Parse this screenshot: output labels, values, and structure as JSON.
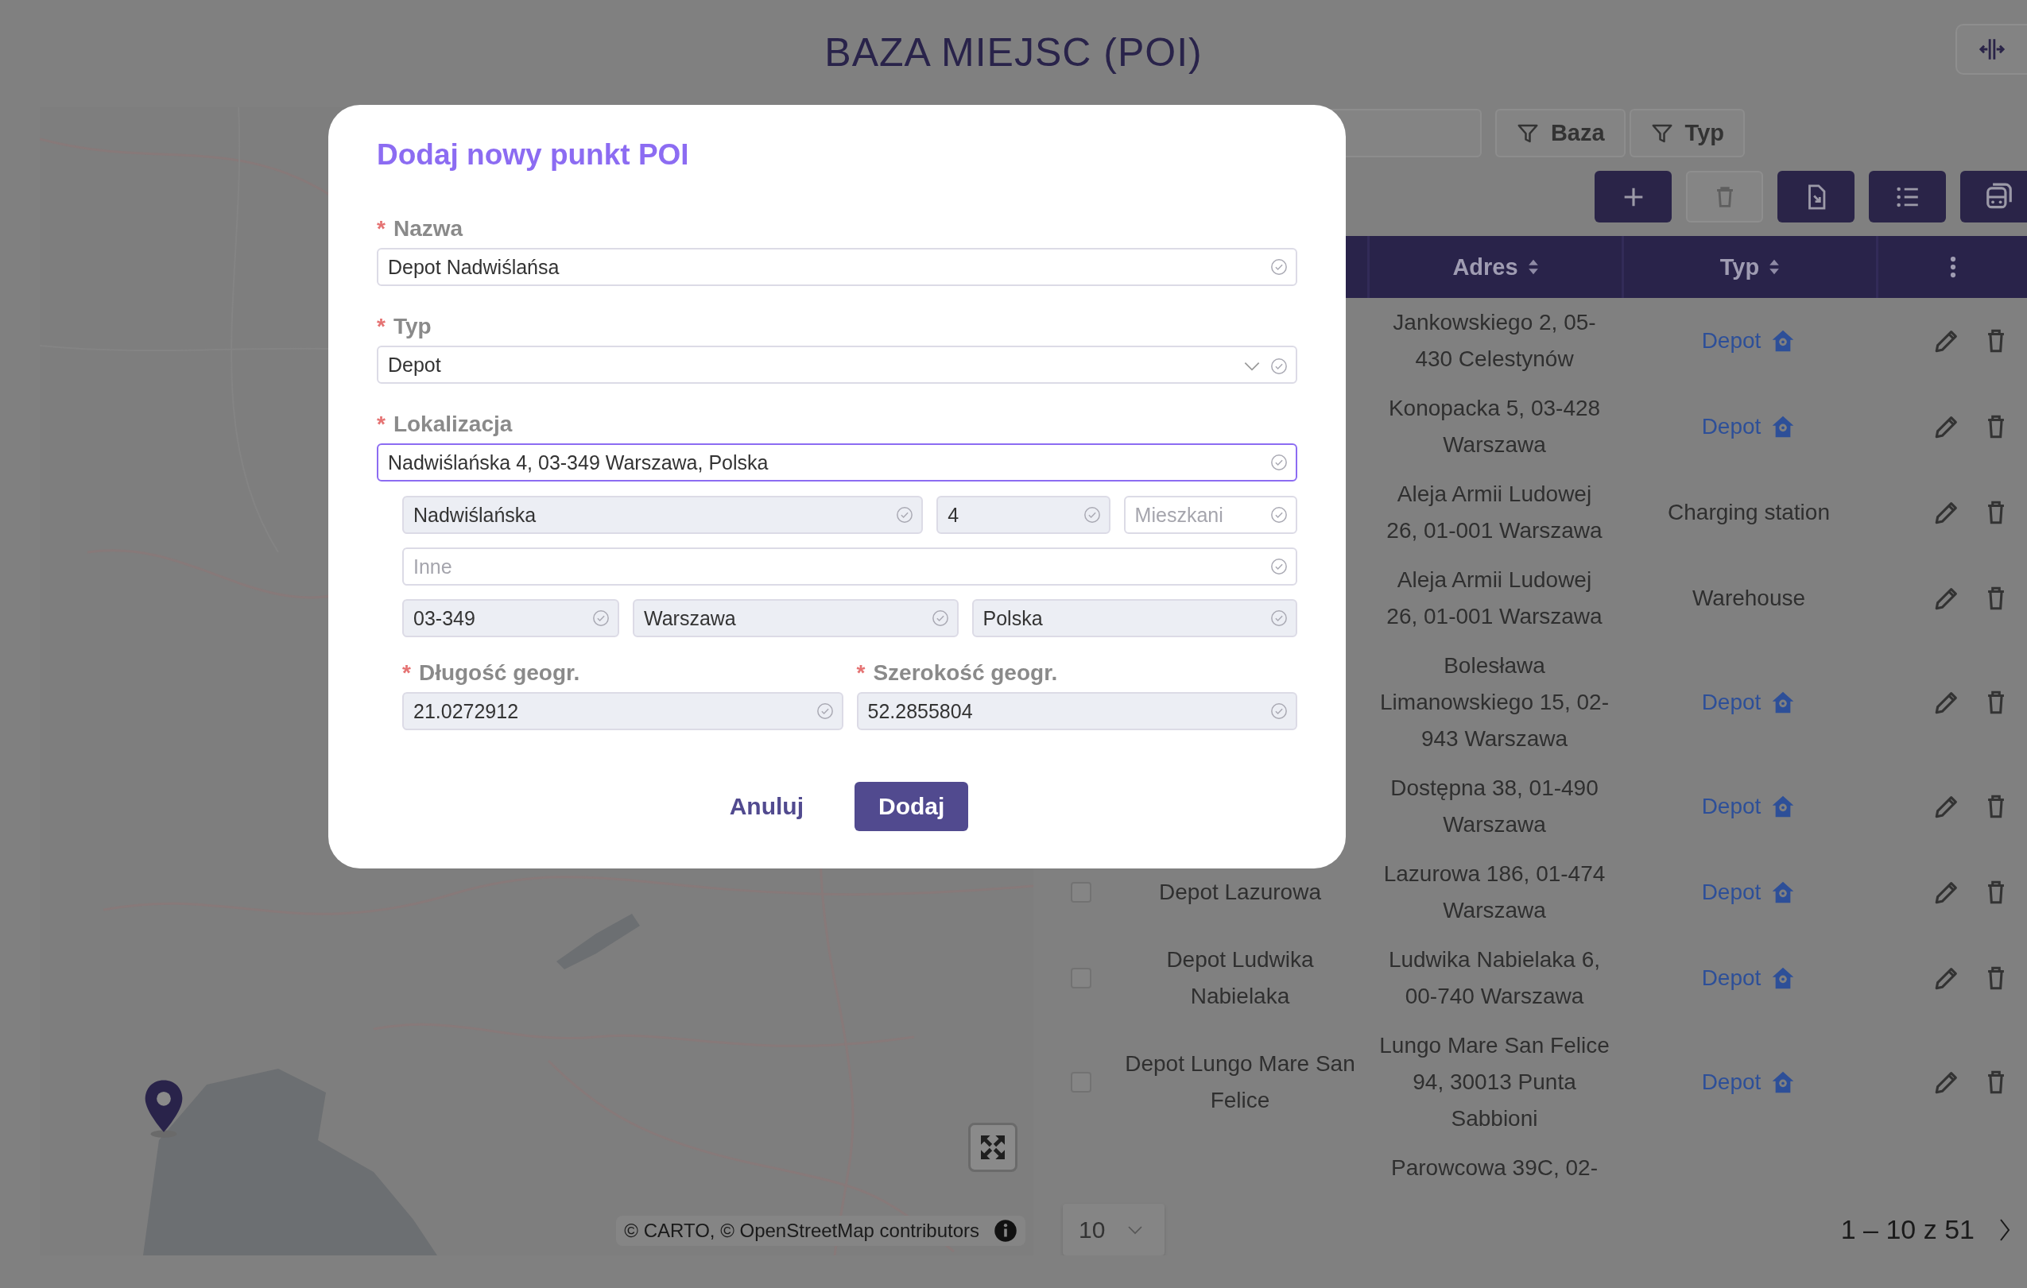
{
  "page": {
    "title": "BAZA MIEJSC (POI)"
  },
  "map": {
    "kind": "picture",
    "attribution": "© CARTO, © OpenStreetMap contributors"
  },
  "toolbar": {
    "filters": [
      {
        "label": "Baza"
      },
      {
        "label": "Typ"
      }
    ],
    "actions": [
      {
        "kind": "plus",
        "disabled": false
      },
      {
        "kind": "trash",
        "disabled": true
      },
      {
        "kind": "file",
        "disabled": false
      },
      {
        "kind": "list",
        "disabled": false
      },
      {
        "kind": "bus",
        "disabled": false
      }
    ]
  },
  "table": {
    "columns": [
      {
        "label": "Adres",
        "sortable": true
      },
      {
        "label": "Typ",
        "sortable": true
      }
    ],
    "rows": [
      {
        "kind": "row",
        "address": "Jankowskiego 2, 05-\n430 Celestynów",
        "type": {
          "label": "Depot",
          "kind": "link"
        }
      },
      {
        "kind": "row",
        "address": "Konopacka 5, 03-428\nWarszawa",
        "type": {
          "label": "Depot",
          "kind": "link"
        }
      },
      {
        "kind": "row",
        "address": "Aleja Armii Ludowej\n26, 01-001 Warszawa",
        "type": {
          "label": "Charging station",
          "kind": "plain"
        }
      },
      {
        "kind": "row",
        "address": "Aleja Armii Ludowej\n26, 01-001 Warszawa",
        "type": {
          "label": "Warehouse",
          "kind": "plain"
        }
      },
      {
        "kind": "row",
        "address": "Bolesława\nLimanowskiego 15, 02-\n943 Warszawa",
        "type": {
          "label": "Depot",
          "kind": "link"
        }
      },
      {
        "kind": "row",
        "address": "Dostępna 38, 01-490\nWarszawa",
        "type": {
          "label": "Depot",
          "kind": "link"
        }
      },
      {
        "kind": "row",
        "checked": false,
        "name": "Depot Lazurowa",
        "address": "Lazurowa 186, 01-474\nWarszawa",
        "type": {
          "label": "Depot",
          "kind": "link"
        }
      },
      {
        "kind": "row",
        "checked": false,
        "name": "Depot Ludwika\nNabielaka",
        "address": "Ludwika Nabielaka 6,\n00-740 Warszawa",
        "type": {
          "label": "Depot",
          "kind": "link"
        }
      },
      {
        "kind": "row",
        "checked": false,
        "name": "Depot Lungo Mare San\nFelice",
        "address": "Lungo Mare San Felice\n94, 30013 Punta\nSabbioni",
        "type": {
          "label": "Depot",
          "kind": "link"
        }
      },
      {
        "kind": "partial",
        "address": "Parowcowa 39C, 02-"
      }
    ]
  },
  "pagination": {
    "page_size": "10",
    "range": "1 – 10 z 51"
  },
  "dialog": {
    "title": "Dodaj nowy punkt POI",
    "required_mark": "*",
    "fields": [
      {
        "label": "Nazwa",
        "required": true,
        "kind": "text",
        "value": "Depot Nadwiślańsa",
        "readonly": false,
        "focused": false
      },
      {
        "label": "Typ",
        "required": true,
        "kind": "select",
        "value": "Depot",
        "readonly": false,
        "focused": false
      },
      {
        "label": "Lokalizacja",
        "required": true,
        "kind": "text",
        "value": "Nadwiślańska 4, 03-349 Warszawa, Polska",
        "readonly": false,
        "focused": true
      }
    ],
    "address_parts": [
      [
        {
          "value": "Nadwiślańska",
          "readonly": true
        },
        {
          "value": "4",
          "readonly": true
        },
        {
          "placeholder": "Mieszkani",
          "readonly": false
        }
      ],
      [
        {
          "placeholder": "Inne",
          "readonly": false
        }
      ],
      [
        {
          "value": "03-349",
          "readonly": true
        },
        {
          "value": "Warszawa",
          "readonly": true
        },
        {
          "value": "Polska",
          "readonly": true
        }
      ]
    ],
    "coordinates": [
      {
        "label": "Długość geogr.",
        "required": true,
        "value": "21.0272912",
        "readonly": true
      },
      {
        "label": "Szerokość geogr.",
        "required": true,
        "value": "52.2855804",
        "readonly": true
      }
    ],
    "buttons": [
      {
        "label": "Anuluj",
        "kind": "text"
      },
      {
        "label": "Dodaj",
        "kind": "primary"
      }
    ]
  }
}
